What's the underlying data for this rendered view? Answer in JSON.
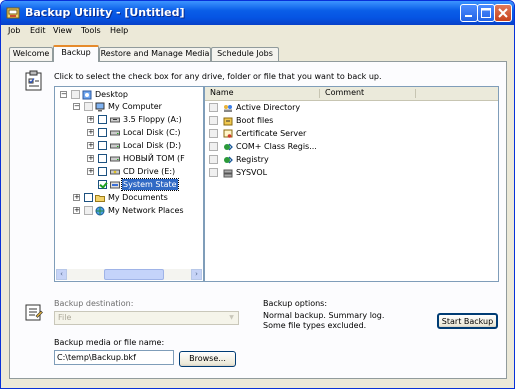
{
  "window": {
    "title": "Backup Utility - [Untitled]"
  },
  "menu": [
    "Job",
    "Edit",
    "View",
    "Tools",
    "Help"
  ],
  "tabs": [
    "Welcome",
    "Backup",
    "Restore and Manage Media",
    "Schedule Jobs"
  ],
  "active_tab": "Backup",
  "instruction": "Click to select the check box for any drive, folder or file that you want to back up.",
  "tree": [
    {
      "label": "Desktop",
      "icon": "desktop-icon",
      "checked": false
    },
    {
      "label": "My Computer",
      "icon": "computer-icon",
      "checked": false
    },
    {
      "label": "3.5 Floppy (A:)",
      "icon": "floppy-drive-icon",
      "checked": false
    },
    {
      "label": "Local Disk (C:)",
      "icon": "hard-disk-icon",
      "checked": false
    },
    {
      "label": "Local Disk (D:)",
      "icon": "hard-disk-icon",
      "checked": false
    },
    {
      "label": "НОВЫЙ ТОМ (F",
      "icon": "hard-disk-icon",
      "checked": false
    },
    {
      "label": "CD Drive (E:)",
      "icon": "cd-drive-icon",
      "checked": false
    },
    {
      "label": "System State",
      "icon": "system-state-icon",
      "checked": true,
      "selected": true
    },
    {
      "label": "My Documents",
      "icon": "folder-icon",
      "checked": false
    },
    {
      "label": "My Network Places",
      "icon": "network-icon",
      "checked": false
    }
  ],
  "list": {
    "columns": [
      "Name",
      "Comment"
    ],
    "items": [
      {
        "name": "Active Directory",
        "icon": "active-directory-icon"
      },
      {
        "name": "Boot files",
        "icon": "boot-files-icon"
      },
      {
        "name": "Certificate Server",
        "icon": "certificate-icon"
      },
      {
        "name": "COM+ Class Regis...",
        "icon": "component-icon"
      },
      {
        "name": "Registry",
        "icon": "registry-icon"
      },
      {
        "name": "SYSVOL",
        "icon": "sysvol-icon"
      }
    ]
  },
  "backup_destination": {
    "label": "Backup destination:",
    "value": "File"
  },
  "backup_media": {
    "label": "Backup media or file name:",
    "value": "C:\\temp\\Backup.bkf",
    "browse_label": "Browse..."
  },
  "backup_options": {
    "label": "Backup options:",
    "line1": "Normal backup.  Summary log.",
    "line2": "Some file types excluded."
  },
  "start_button": "Start Backup",
  "colors": {
    "titlebar": "#0a5ee8",
    "selection": "#316ac5",
    "tab_highlight": "#e68b2c",
    "dialog_bg": "#ece9d8"
  }
}
